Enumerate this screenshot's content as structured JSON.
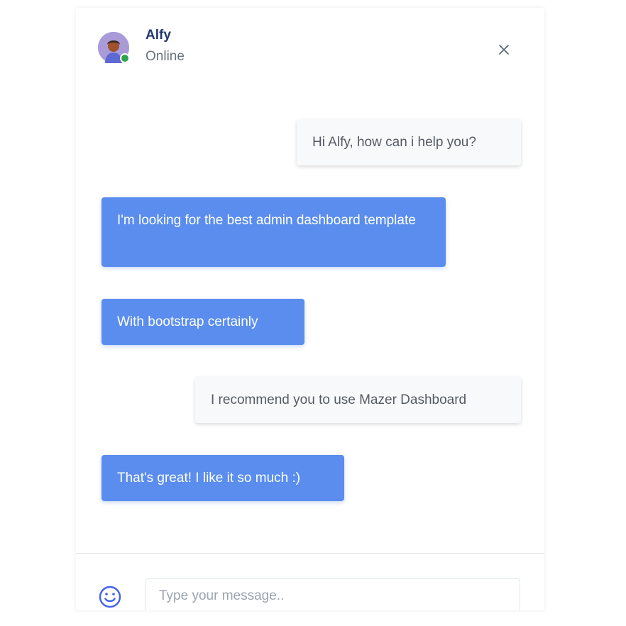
{
  "contact": {
    "name": "Alfy",
    "status": "Online",
    "avatar_icon": "avatar-illustration"
  },
  "messages": [
    {
      "side": "incoming",
      "text": "Hi Alfy, how can i help you?"
    },
    {
      "side": "outgoing",
      "text": "I'm looking for the best admin dashboard template"
    },
    {
      "side": "outgoing",
      "text": "With bootstrap certainly"
    },
    {
      "side": "incoming",
      "text": "I recommend you to use Mazer Dashboard"
    },
    {
      "side": "outgoing",
      "text": "That's great! I like it so much :)"
    }
  ],
  "composer": {
    "placeholder": "Type your message..",
    "value": "",
    "emoji_icon": "smile-icon"
  },
  "colors": {
    "primary": "#5a8dee",
    "online": "#2ea44f",
    "title": "#25396f"
  }
}
